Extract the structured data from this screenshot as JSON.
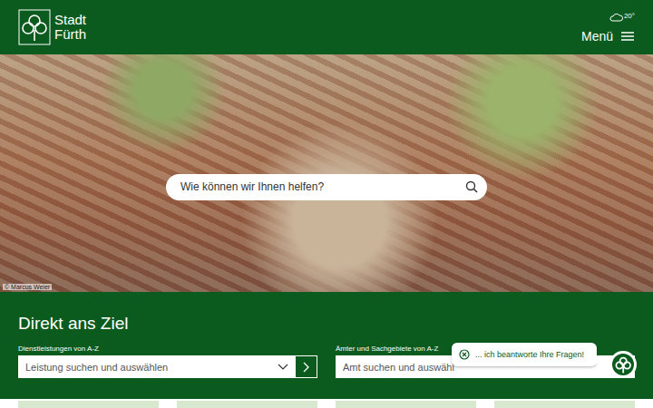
{
  "header": {
    "logo": {
      "line1": "Stadt",
      "line2": "Fürth"
    },
    "weather": {
      "temperature": "20°"
    },
    "menu": {
      "label": "Menü"
    }
  },
  "hero": {
    "credit": "© Marcus Weier",
    "search": {
      "placeholder": "Wie können wir Ihnen helfen?"
    }
  },
  "direct": {
    "title": "Direkt ans Ziel",
    "fields": [
      {
        "label": "Dienstleistungen von A-Z",
        "placeholder": "Leistung suchen und auswählen",
        "kind": "with-button"
      },
      {
        "label": "Ämter und Sachgebiete von A-Z",
        "placeholder": "Amt suchen und auswähl",
        "kind": "plain"
      }
    ]
  },
  "chat": {
    "message": "... ich beantworte Ihre Fragen!"
  }
}
